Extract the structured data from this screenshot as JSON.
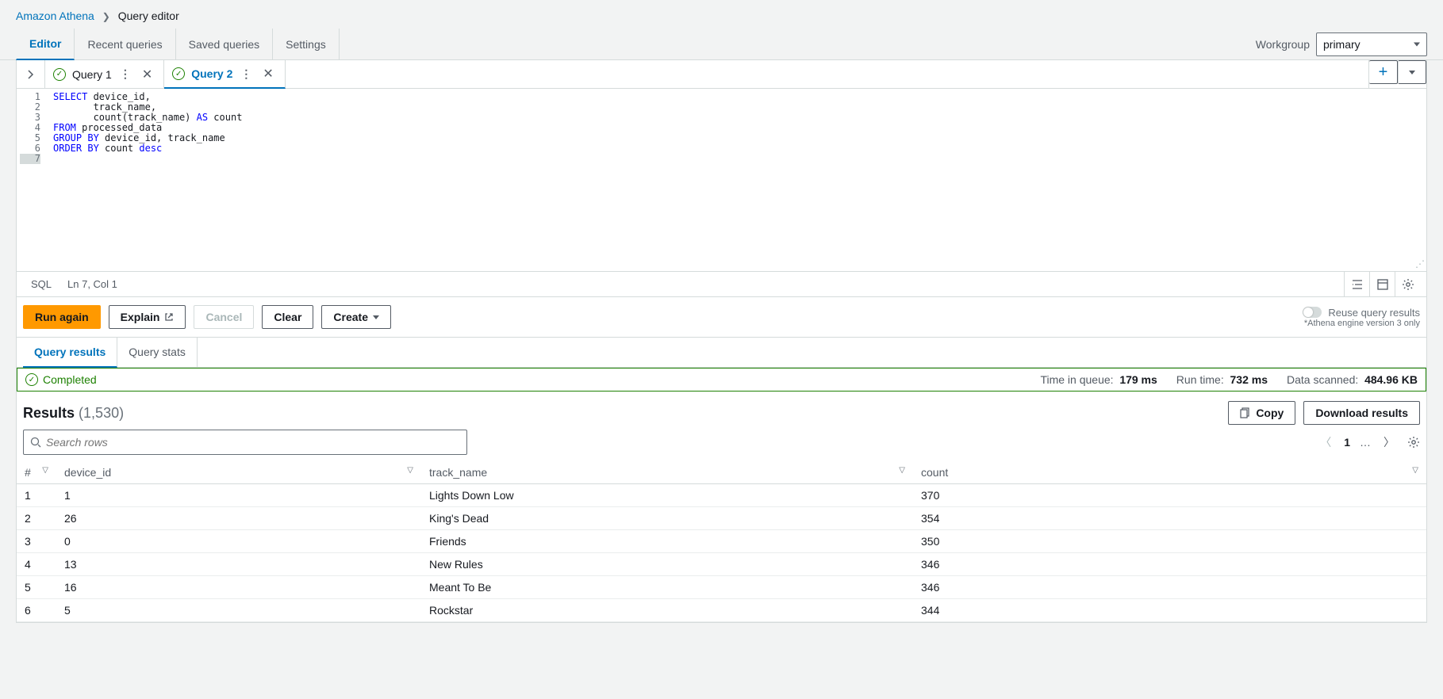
{
  "breadcrumb": {
    "root": "Amazon Athena",
    "current": "Query editor"
  },
  "mainTabs": {
    "editor": "Editor",
    "recent": "Recent queries",
    "saved": "Saved queries",
    "settings": "Settings"
  },
  "workgroup": {
    "label": "Workgroup",
    "value": "primary"
  },
  "queryTabs": [
    {
      "name": "Query 1",
      "status": "ok"
    },
    {
      "name": "Query 2",
      "status": "ok"
    }
  ],
  "code": {
    "lines": [
      [
        {
          "t": "SELECT",
          "c": "kw"
        },
        {
          "t": " device_id,",
          "c": "id"
        }
      ],
      [
        {
          "t": "       track_name,",
          "c": "id"
        }
      ],
      [
        {
          "t": "       count",
          "c": "fn"
        },
        {
          "t": "(track_name) ",
          "c": "id"
        },
        {
          "t": "AS",
          "c": "kw"
        },
        {
          "t": " count",
          "c": "id"
        }
      ],
      [
        {
          "t": "FROM",
          "c": "kw"
        },
        {
          "t": " processed_data",
          "c": "id"
        }
      ],
      [
        {
          "t": "GROUP BY",
          "c": "kw"
        },
        {
          "t": " device_id, track_name",
          "c": "id"
        }
      ],
      [
        {
          "t": "ORDER BY",
          "c": "kw"
        },
        {
          "t": " count ",
          "c": "id"
        },
        {
          "t": "desc",
          "c": "kw"
        }
      ],
      [
        {
          "t": "",
          "c": "id"
        }
      ]
    ],
    "currentLine": 7
  },
  "statusStrip": {
    "lang": "SQL",
    "pos": "Ln 7, Col 1"
  },
  "actions": {
    "run": "Run again",
    "explain": "Explain",
    "cancel": "Cancel",
    "clear": "Clear",
    "create": "Create"
  },
  "reuse": {
    "label": "Reuse query results",
    "note": "*Athena engine version 3 only"
  },
  "resultTabs": {
    "results": "Query results",
    "stats": "Query stats"
  },
  "completed": {
    "status": "Completed",
    "queueLabel": "Time in queue:",
    "queue": "179 ms",
    "runLabel": "Run time:",
    "run": "732 ms",
    "scanLabel": "Data scanned:",
    "scan": "484.96 KB"
  },
  "results": {
    "title": "Results",
    "count": "(1,530)",
    "copy": "Copy",
    "download": "Download results",
    "searchPlaceholder": "Search rows",
    "page": "1",
    "columns": {
      "idx": "#",
      "device": "device_id",
      "track": "track_name",
      "count": "count"
    },
    "rows": [
      {
        "i": "1",
        "device": "1",
        "track": "Lights Down Low",
        "count": "370"
      },
      {
        "i": "2",
        "device": "26",
        "track": "King's Dead",
        "count": "354"
      },
      {
        "i": "3",
        "device": "0",
        "track": "Friends",
        "count": "350"
      },
      {
        "i": "4",
        "device": "13",
        "track": "New Rules",
        "count": "346"
      },
      {
        "i": "5",
        "device": "16",
        "track": "Meant To Be",
        "count": "346"
      },
      {
        "i": "6",
        "device": "5",
        "track": "Rockstar",
        "count": "344"
      }
    ]
  }
}
